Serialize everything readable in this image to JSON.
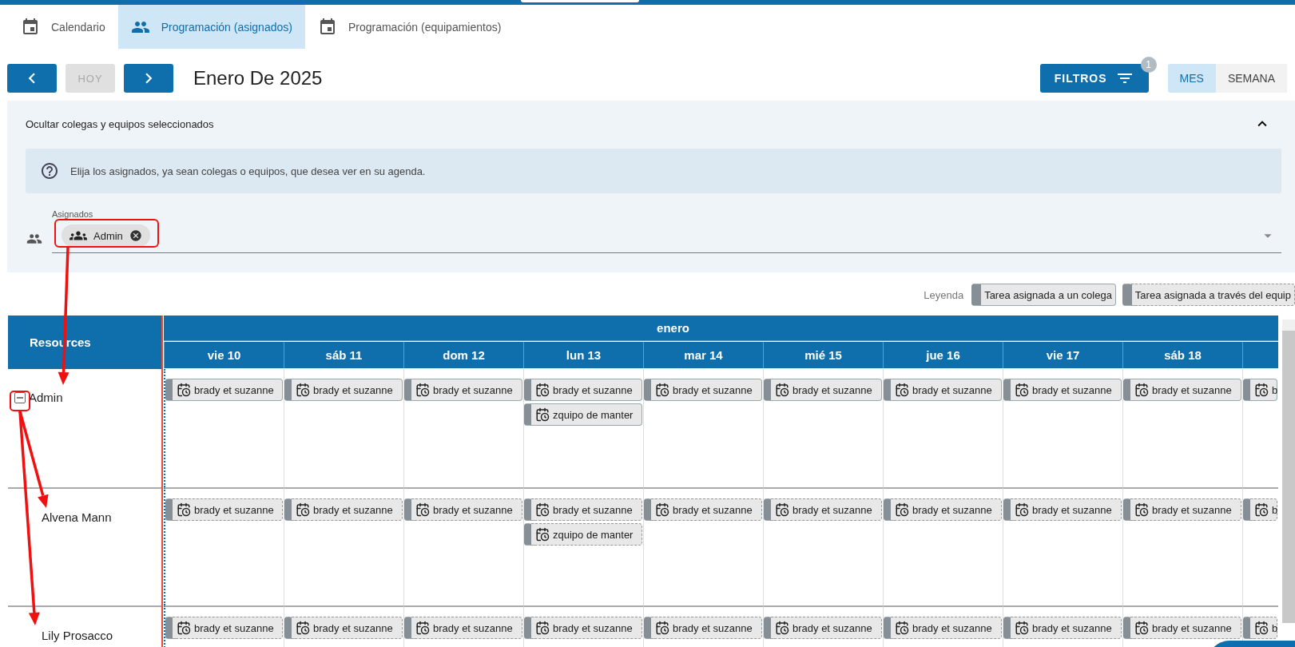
{
  "tabs": [
    {
      "label": "Calendario",
      "selected": false
    },
    {
      "label": "Programación (asignados)",
      "selected": true
    },
    {
      "label": "Programación (equipamientos)",
      "selected": false
    }
  ],
  "toolbar": {
    "today": {
      "label": "HOY",
      "disabled": true
    },
    "title": "Enero De 2025",
    "filters": {
      "label": "FILTROS",
      "badge": "1"
    },
    "views": [
      {
        "label": "MES",
        "selected": true
      },
      {
        "label": "SEMANA",
        "selected": false
      }
    ]
  },
  "assignee_panel": {
    "title": "Ocultar colegas y equipos seleccionados",
    "expanded": true,
    "info": "Elija los asignados, ya sean colegas o equipos, que desea ver en su agenda.",
    "field": {
      "label": "Asignados",
      "chips": [
        "Admin"
      ]
    }
  },
  "legend": {
    "label": "Leyenda",
    "items": [
      {
        "label": "Tarea asignada a un colega",
        "kind": "colleague"
      },
      {
        "label": "Tarea asignada a través del equip",
        "kind": "team"
      }
    ]
  },
  "schedule": {
    "resources_heading": "Resources",
    "month": "enero",
    "days": [
      "vie 10",
      "sáb 11",
      "dom 12",
      "lun 13",
      "mar 14",
      "mié 15",
      "jue 16",
      "vie 17",
      "sáb 18"
    ],
    "rows": [
      {
        "name": "Admin",
        "expanded": true,
        "kind": "colleague",
        "cells": [
          [
            "brady et suzanne"
          ],
          [
            "brady et suzanne"
          ],
          [
            "brady et suzanne"
          ],
          [
            "brady et suzanne",
            "zquipo de manter"
          ],
          [
            "brady et suzanne"
          ],
          [
            "brady et suzanne"
          ],
          [
            "brady et suzanne"
          ],
          [
            "brady et suzanne"
          ],
          [
            "brady et suzanne"
          ],
          [
            "b"
          ]
        ],
        "children": [
          {
            "name": "Alvena Mann",
            "kind": "team",
            "cells": [
              [
                "brady et suzanne"
              ],
              [
                "brady et suzanne"
              ],
              [
                "brady et suzanne"
              ],
              [
                "brady et suzanne",
                "zquipo de manter"
              ],
              [
                "brady et suzanne"
              ],
              [
                "brady et suzanne"
              ],
              [
                "brady et suzanne"
              ],
              [
                "brady et suzanne"
              ],
              [
                "brady et suzanne"
              ],
              [
                "b"
              ]
            ]
          },
          {
            "name": "Lily Prosacco",
            "kind": "team",
            "cells": [
              [
                "brady et suzanne"
              ],
              [
                "brady et suzanne"
              ],
              [
                "brady et suzanne"
              ],
              [
                "brady et suzanne"
              ],
              [
                "brady et suzanne"
              ],
              [
                "brady et suzanne"
              ],
              [
                "brady et suzanne"
              ],
              [
                "brady et suzanne"
              ],
              [
                "brady et suzanne"
              ],
              [
                "b"
              ]
            ]
          }
        ]
      }
    ]
  }
}
